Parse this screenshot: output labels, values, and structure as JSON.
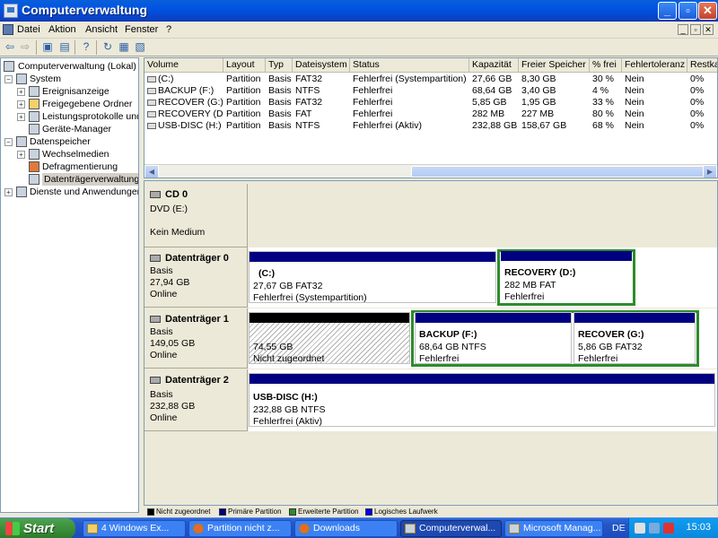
{
  "window": {
    "title": "Computerverwaltung",
    "buttons": {
      "minimize": "_",
      "maximize": "▫",
      "close": "✕"
    }
  },
  "menu": {
    "items": [
      "Datei",
      "Aktion",
      "Ansicht",
      "Fenster",
      "?"
    ],
    "mdi_buttons": [
      "_",
      "▫",
      "✕"
    ]
  },
  "toolbar": {
    "icons": [
      "back-arrow-icon",
      "forward-arrow-icon",
      "up-folder-icon",
      "show-tree-icon",
      "help-icon",
      "refresh-icon",
      "properties-icon",
      "export-icon"
    ]
  },
  "tree": {
    "root": "Computerverwaltung (Lokal)",
    "nodes": [
      {
        "label": "System",
        "expander": "−",
        "level": 1
      },
      {
        "label": "Ereignisanzeige",
        "expander": "+",
        "level": 2
      },
      {
        "label": "Freigegebene Ordner",
        "expander": "+",
        "level": 2
      },
      {
        "label": "Leistungsprotokolle und",
        "expander": "+",
        "level": 2
      },
      {
        "label": "Geräte-Manager",
        "expander": "",
        "level": 2
      },
      {
        "label": "Datenspeicher",
        "expander": "−",
        "level": 1
      },
      {
        "label": "Wechselmedien",
        "expander": "+",
        "level": 2
      },
      {
        "label": "Defragmentierung",
        "expander": "",
        "level": 2
      },
      {
        "label": "Datenträgerverwaltung",
        "expander": "",
        "level": 2
      },
      {
        "label": "Dienste und Anwendungen",
        "expander": "+",
        "level": 1
      }
    ]
  },
  "volumes": {
    "columns": [
      "Volume",
      "Layout",
      "Typ",
      "Dateisystem",
      "Status",
      "Kapazität",
      "Freier Speicher",
      "% frei",
      "Fehlertoleranz",
      "Restka"
    ],
    "rows": [
      [
        "(C:)",
        "Partition",
        "Basis",
        "FAT32",
        "Fehlerfrei (Systempartition)",
        "27,66 GB",
        "8,30 GB",
        "30 %",
        "Nein",
        "0%"
      ],
      [
        "BACKUP (F:)",
        "Partition",
        "Basis",
        "NTFS",
        "Fehlerfrei",
        "68,64 GB",
        "3,40 GB",
        "4 %",
        "Nein",
        "0%"
      ],
      [
        "RECOVER (G:)",
        "Partition",
        "Basis",
        "FAT32",
        "Fehlerfrei",
        "5,85 GB",
        "1,95 GB",
        "33 %",
        "Nein",
        "0%"
      ],
      [
        "RECOVERY (D:)",
        "Partition",
        "Basis",
        "FAT",
        "Fehlerfrei",
        "282 MB",
        "227 MB",
        "80 %",
        "Nein",
        "0%"
      ],
      [
        "USB-DISC (H:)",
        "Partition",
        "Basis",
        "NTFS",
        "Fehlerfrei (Aktiv)",
        "232,88 GB",
        "158,67 GB",
        "68 %",
        "Nein",
        "0%"
      ]
    ]
  },
  "disks": {
    "cd0": {
      "title": "CD 0",
      "type": "DVD (E:)",
      "status": "Kein Medium"
    },
    "disk0": {
      "title": "Datenträger 0",
      "type": "Basis",
      "size": "27,94 GB",
      "status": "Online",
      "partitions": [
        {
          "name": "(C:)",
          "size": "27,67 GB FAT32",
          "status": "Fehlerfrei (Systempartition)"
        },
        {
          "name": "RECOVERY  (D:)",
          "size": "282 MB FAT",
          "status": "Fehlerfrei"
        }
      ]
    },
    "disk1": {
      "title": "Datenträger 1",
      "type": "Basis",
      "size": "149,05 GB",
      "status": "Online",
      "partitions": [
        {
          "name": "",
          "size": "74,55 GB",
          "status": "Nicht zugeordnet"
        },
        {
          "name": "BACKUP  (F:)",
          "size": "68,64 GB NTFS",
          "status": "Fehlerfrei"
        },
        {
          "name": "RECOVER  (G:)",
          "size": "5,86 GB FAT32",
          "status": "Fehlerfrei"
        }
      ]
    },
    "disk2": {
      "title": "Datenträger 2",
      "type": "Basis",
      "size": "232,88 GB",
      "status": "Online",
      "partitions": [
        {
          "name": "USB-DISC  (H:)",
          "size": "232,88 GB NTFS",
          "status": "Fehlerfrei (Aktiv)"
        }
      ]
    }
  },
  "legend": [
    {
      "label": "Nicht zugeordnet",
      "color": "#000000"
    },
    {
      "label": "Primäre Partition",
      "color": "#000080"
    },
    {
      "label": "Erweiterte Partition",
      "color": "#2e8b2e"
    },
    {
      "label": "Logisches Laufwerk",
      "color": "#0000ff"
    }
  ],
  "taskbar": {
    "start": "Start",
    "tasks": [
      "4 Windows Ex...",
      "Partition nicht z...",
      "Downloads",
      "Computerverwal...",
      "Microsoft Manag..."
    ],
    "language": "DE",
    "clock": "15:03"
  }
}
